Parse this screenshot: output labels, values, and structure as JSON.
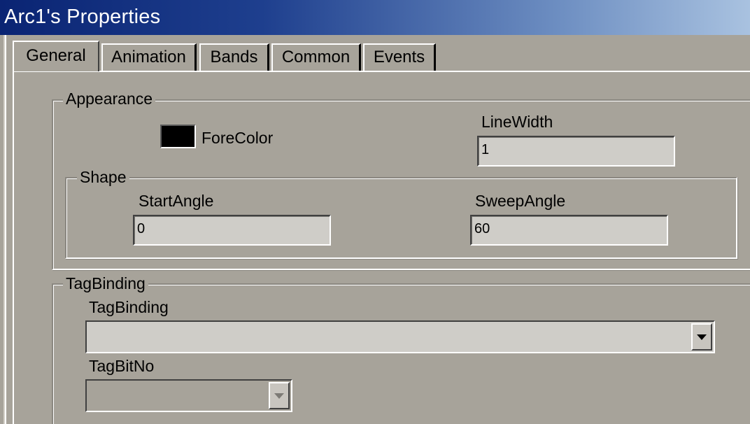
{
  "window": {
    "title": "Arc1's Properties"
  },
  "tabs": [
    {
      "label": "General",
      "selected": true
    },
    {
      "label": "Animation"
    },
    {
      "label": "Bands"
    },
    {
      "label": "Common"
    },
    {
      "label": "Events"
    }
  ],
  "appearance": {
    "group_label": "Appearance",
    "forecolor_label": "ForeColor",
    "forecolor_value": "#000000",
    "linewidth_label": "LineWidth",
    "linewidth_value": "1"
  },
  "shape": {
    "group_label": "Shape",
    "startangle_label": "StartAngle",
    "startangle_value": "0",
    "sweepangle_label": "SweepAngle",
    "sweepangle_value": "60"
  },
  "tagbinding": {
    "group_label": "TagBinding",
    "tagbinding_label": "TagBinding",
    "tagbinding_value": "",
    "tagbitno_label": "TagBitNo",
    "tagbitno_value": ""
  },
  "colors": {
    "title_bar_start": "#0a2473",
    "title_bar_end": "#a9c2e0",
    "dialog_background": "#a7a39a",
    "field_background": "#cfcdc8"
  }
}
